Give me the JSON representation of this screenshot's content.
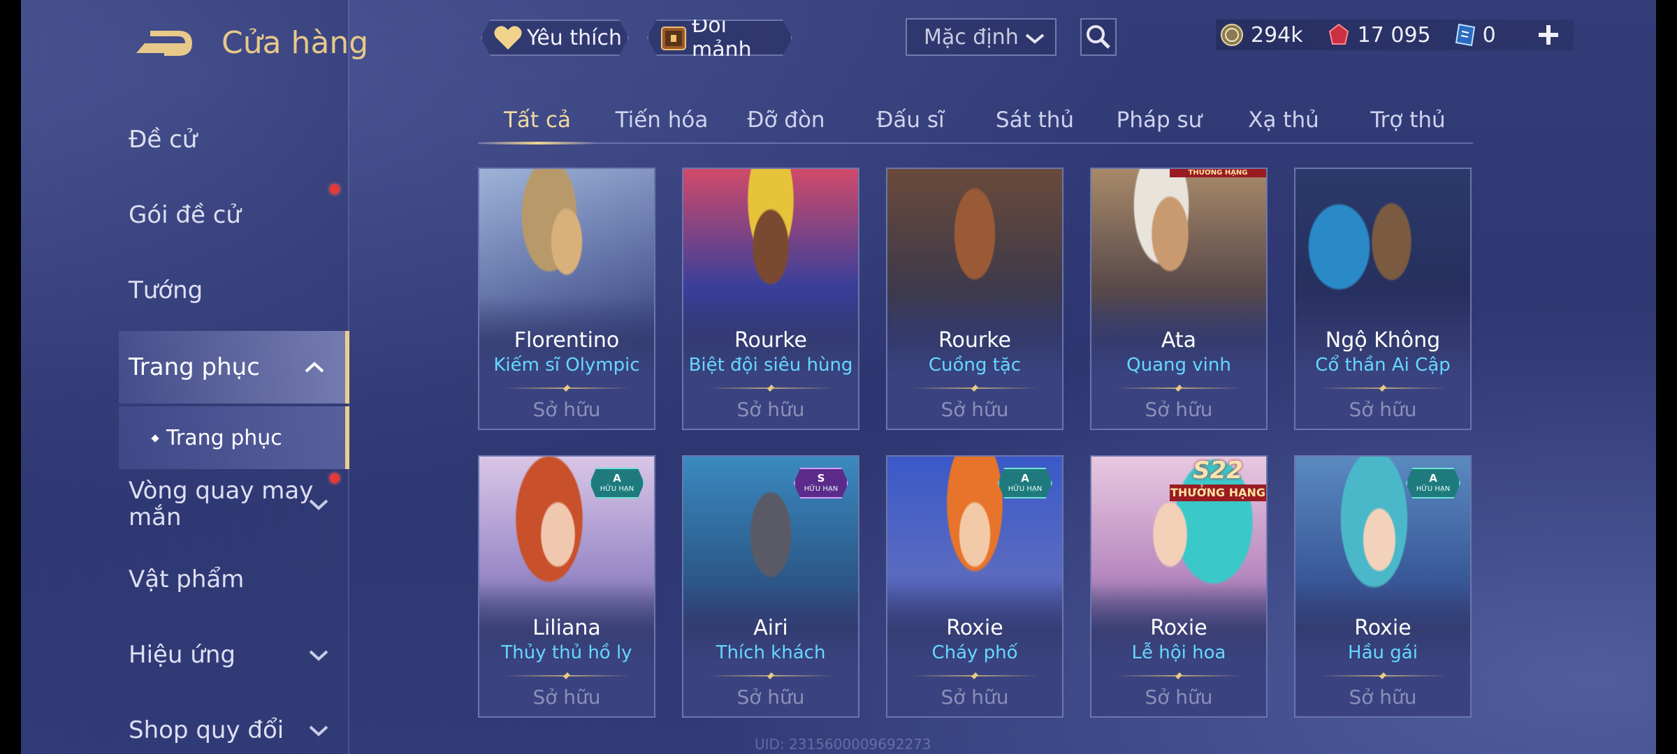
{
  "header": {
    "title": "Cửa hàng"
  },
  "sidebar": {
    "items": [
      {
        "label": "Đề cử"
      },
      {
        "label": "Gói đề cử"
      },
      {
        "label": "Tướng"
      },
      {
        "label": "Trang phục"
      },
      {
        "label": "Vòng quay may mắn"
      },
      {
        "label": "Vật phẩm"
      },
      {
        "label": "Hiệu ứng"
      },
      {
        "label": "Shop quy đổi"
      }
    ],
    "sub_item": {
      "label": "Trang phục"
    }
  },
  "topbar": {
    "favorite_label": "Yêu thích",
    "exchange_label": "Đổi mảnh",
    "sort_value": "Mặc định",
    "currencies": {
      "gold": "294k",
      "ruby": "17 095",
      "voucher": "0"
    }
  },
  "tabs": [
    {
      "label": "Tất cả"
    },
    {
      "label": "Tiến hóa"
    },
    {
      "label": "Đỡ đòn"
    },
    {
      "label": "Đấu sĩ"
    },
    {
      "label": "Sát thủ"
    },
    {
      "label": "Pháp sư"
    },
    {
      "label": "Xạ thủ"
    },
    {
      "label": "Trợ thủ"
    }
  ],
  "cards": [
    {
      "hero": "Florentino",
      "skin": "Kiếm sĩ Olympic",
      "status": "Sở hữu"
    },
    {
      "hero": "Rourke",
      "skin": "Biệt đội siêu hùng",
      "status": "Sở hữu"
    },
    {
      "hero": "Rourke",
      "skin": "Cuồng tặc",
      "status": "Sở hữu"
    },
    {
      "hero": "Ata",
      "skin": "Quang vinh",
      "status": "Sở hữu"
    },
    {
      "hero": "Ngộ Không",
      "skin": "Cổ thần Ai Cập",
      "status": "Sở hữu"
    },
    {
      "hero": "Liliana",
      "skin": "Thủy thủ hồ ly",
      "status": "Sở hữu",
      "badge": {
        "tier": "A",
        "text": "HỮU HẠN"
      }
    },
    {
      "hero": "Airi",
      "skin": "Thích khách",
      "status": "Sở hữu",
      "badge": {
        "tier": "S",
        "text": "HỮU HẠN"
      }
    },
    {
      "hero": "Roxie",
      "skin": "Cháy phố",
      "status": "Sở hữu",
      "badge": {
        "tier": "A",
        "text": "HỮU HẠN"
      }
    },
    {
      "hero": "Roxie",
      "skin": "Lễ hội hoa",
      "status": "Sở hữu",
      "rank_badge": {
        "season": "S22",
        "text": "THƯỞNG HẠNG"
      }
    },
    {
      "hero": "Roxie",
      "skin": "Hầu gái",
      "status": "Sở hữu",
      "badge": {
        "tier": "A",
        "text": "HỮU HẠN"
      }
    }
  ],
  "rank_strip": "THƯỞNG HẠNG",
  "uid": "UID: 2315600009692273",
  "colors": {
    "gold_accent": "#e8c98a",
    "skin_name": "#66d7ff",
    "background": "#2d3670",
    "notification": "#e53935"
  },
  "icons": [
    "back-arrow-icon",
    "heart-icon",
    "chest-icon",
    "chevron-down-icon",
    "search-icon",
    "gold-coin-icon",
    "ruby-icon",
    "voucher-icon",
    "plus-icon",
    "chevron-up-icon"
  ]
}
